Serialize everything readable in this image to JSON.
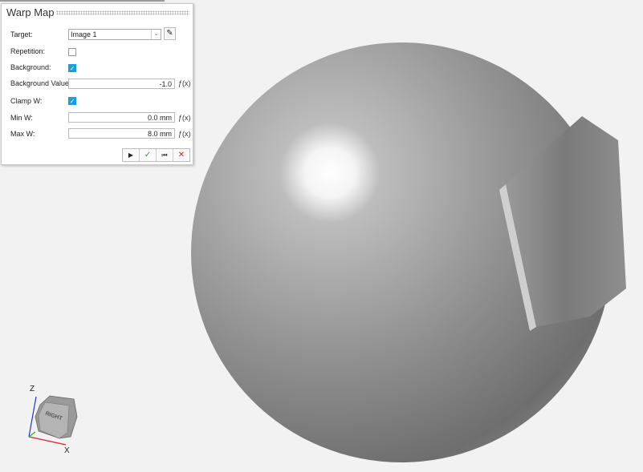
{
  "panel": {
    "title": "Warp Map",
    "target_label": "Target:",
    "target_value": "Image 1",
    "repetition_label": "Repetition:",
    "repetition_checked": false,
    "background_label": "Background:",
    "background_checked": true,
    "background_value_label": "Background Value:",
    "background_value": "-1.0",
    "clamp_label": "Clamp W:",
    "clamp_checked": true,
    "min_label": "Min W:",
    "min_value": "0.0 mm",
    "max_label": "Max W:",
    "max_value": "8.0 mm",
    "fx": "ƒ(x)",
    "buttons": {
      "run": "▶",
      "ok": "✓",
      "reset": "⏮",
      "cancel": "✕"
    }
  },
  "view_cube": {
    "face_label": "RIGHT",
    "axis_z": "Z",
    "axis_x": "X"
  },
  "colors": {
    "check": "#1a9ee0",
    "ok": "#2a9d2a",
    "cancel": "#d02020"
  }
}
